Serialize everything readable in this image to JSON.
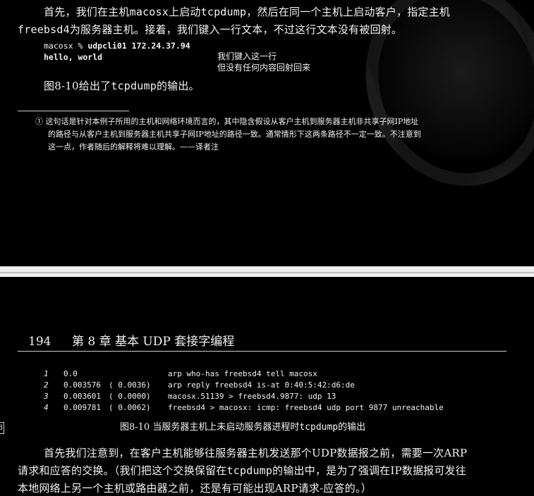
{
  "page1": {
    "intro_line1_a": "首先，我们在主机",
    "intro_line1_host": "macosx",
    "intro_line1_b": "上启动",
    "intro_line1_tool": "tcpdump",
    "intro_line1_c": "，然后在同一个主机上启动客户，指定主机",
    "intro_line2_host": "freebsd4",
    "intro_line2_b": "为服务器主机。接着，我们键入一行文本，不过这行文本没有被回射。",
    "code_prompt": "macosx % ",
    "code_cmd": "udpcli01 172.24.37.94",
    "code_input": "hello, world",
    "note_line1": "我们键入这一行",
    "note_line2": "但没有任何内容回射回来",
    "fig_ref_a": "图8-10给出了",
    "fig_ref_tool": "tcpdump",
    "fig_ref_b": "的输出。",
    "footnote_line1": "① 这句话是针对本例子所用的主机和网络环境而言的，其中隐含假设从客户主机到服务器主机非共享子网IP地址",
    "footnote_line2": "的路径与从客户主机到服务器主机共享子网IP地址的路径一致。通常情形下这两条路径不一定一致。不注意到",
    "footnote_line3": "这一点，作者随后的解释将难以理解。——译者注"
  },
  "page2": {
    "page_number": "194",
    "chapter": "第 8 章   基本 UDP 套接字编程",
    "output_rows": [
      {
        "idx": "1",
        "time": "0.0",
        "delta": "",
        "msg": "arp who-has freebsd4 tell macosx"
      },
      {
        "idx": "2",
        "time": "0.003576",
        "delta": "( 0.0036)",
        "msg": "arp reply freebsd4 is-at 0:40:5:42:d6:de"
      },
      {
        "idx": "3",
        "time": "0.003601",
        "delta": "( 0.0000)",
        "msg": "macosx.51139 > freebsd4.9877: udp 13"
      },
      {
        "idx": "4",
        "time": "0.009781",
        "delta": "( 0.0062)",
        "msg": "freebsd4 > macosx: icmp: freebsd4 udp port 9877 unreachable"
      }
    ],
    "edge_mark": "8",
    "caption_a": "图8-10   当服务器主机上未启动服务器进程时",
    "caption_tool": "tcpdump",
    "caption_b": "的输出",
    "body_line1": "首先我们注意到，在客户主机能够往服务器主机发送那个UDP数据报之前，需要一次ARP",
    "body_line2_a": "请求和应答的交换。（我们把这个交换保留在",
    "body_line2_tool": "tcpdump",
    "body_line2_b": "的输出中，是为了强调在IP数据报可发往",
    "body_line3": "本地网络上另一个主机或路由器之前，还是有可能出现ARP请求-应答的。）"
  }
}
